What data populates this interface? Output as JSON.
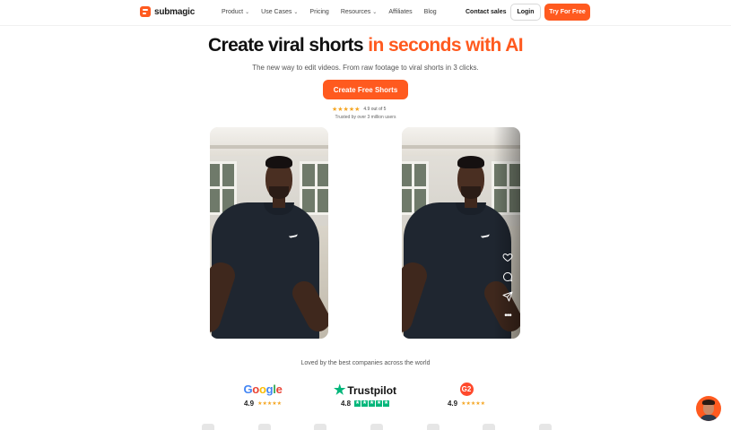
{
  "brand": {
    "name": "submagic",
    "accent": "#ff5a1f"
  },
  "nav": {
    "items": [
      {
        "label": "Product",
        "has_dropdown": true
      },
      {
        "label": "Use Cases",
        "has_dropdown": true
      },
      {
        "label": "Pricing",
        "has_dropdown": false
      },
      {
        "label": "Resources",
        "has_dropdown": true
      },
      {
        "label": "Affiliates",
        "has_dropdown": false
      },
      {
        "label": "Blog",
        "has_dropdown": false
      }
    ],
    "contact": "Contact sales",
    "login": "Login",
    "try_free": "Try For Free"
  },
  "hero": {
    "headline_plain": "Create viral shorts",
    "headline_accent": "in seconds with AI",
    "subheadline": "The new way to edit videos. From raw footage to viral shorts in 3 clicks.",
    "cta": "Create Free Shorts",
    "rating_stars": "★★★★★",
    "rating_text": "4.9 out of 5",
    "trusted": "Trusted by over 3 million users"
  },
  "videos": {
    "right_icons": [
      "heart-icon",
      "comment-icon",
      "share-icon",
      "more-icon"
    ]
  },
  "social_proof": {
    "heading": "Loved by the best companies across the world",
    "reviews": [
      {
        "platform": "Google",
        "score": "4.9",
        "stars": "★★★★★"
      },
      {
        "platform": "Trustpilot",
        "score": "4.8",
        "stars": "★★★★★"
      },
      {
        "platform": "G2",
        "score": "4.9",
        "stars": "★★★★★"
      }
    ]
  },
  "colors": {
    "google_blue": "#4285F4",
    "google_red": "#EA4335",
    "google_yellow": "#FBBC05",
    "google_green": "#34A853",
    "trustpilot_green": "#00b67a",
    "g2_red": "#ff492c",
    "star_gold": "#f5a623"
  }
}
